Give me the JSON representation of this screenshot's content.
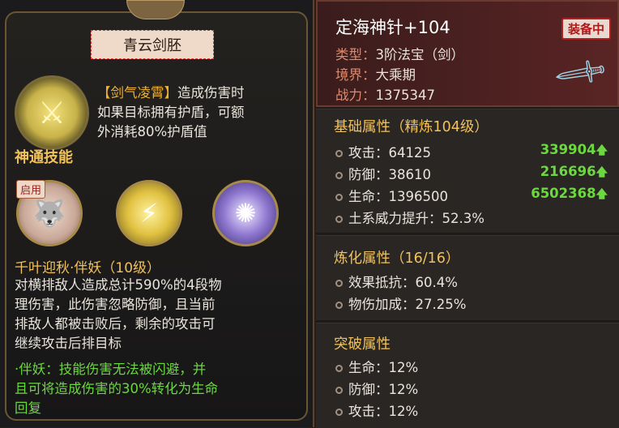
{
  "left": {
    "name_plate": "青云剑胚",
    "passive_prefix": "【剑气凌霄】",
    "passive_line1": "造成伤害时",
    "passive_line2": "如果目标拥有护盾，可额",
    "passive_line3": "外消耗80%护盾值",
    "section_title": "神通技能",
    "enabled_badge": "启用",
    "skill_name": "千叶迎秋·伴妖（10级）",
    "desc_line1": "对横排敌人造成总计590%的4段物",
    "desc_line2": "理伤害，此伤害忽略防御，且当前",
    "desc_line3": "排敌人都被击败后，剩余的攻击可",
    "desc_line4": "继续攻击后排目标",
    "green_line1": "·伴妖：技能伤害无法被闪避，并",
    "green_line2": "且可将造成伤害的30%转化为生命",
    "green_line3": "回复"
  },
  "right": {
    "title": "定海神针+104",
    "equipped_badge": "装备中",
    "type_label": "类型：",
    "type_value": "3阶法宝（剑）",
    "realm_label": "境界：",
    "realm_value": "大乘期",
    "power_label": "战力：",
    "power_value": "1375347",
    "base_title": "基础属性（精炼104级）",
    "base_attrs": [
      {
        "label": "攻击：",
        "value": "64125",
        "bonus": "339904"
      },
      {
        "label": "防御：",
        "value": "38610",
        "bonus": "216696"
      },
      {
        "label": "生命：",
        "value": "1396500",
        "bonus": "6502368"
      },
      {
        "label": "土系威力提升：",
        "value": "52.3%",
        "bonus": ""
      }
    ],
    "refine_title": "炼化属性（16/16）",
    "refine_attrs": [
      {
        "label": "效果抵抗：",
        "value": "60.4%"
      },
      {
        "label": "物伤加成：",
        "value": "27.25%"
      }
    ],
    "break_title": "突破属性",
    "break_attrs": [
      {
        "label": "生命：",
        "value": "12%"
      },
      {
        "label": "防御：",
        "value": "12%"
      },
      {
        "label": "攻击：",
        "value": "12%"
      }
    ]
  }
}
